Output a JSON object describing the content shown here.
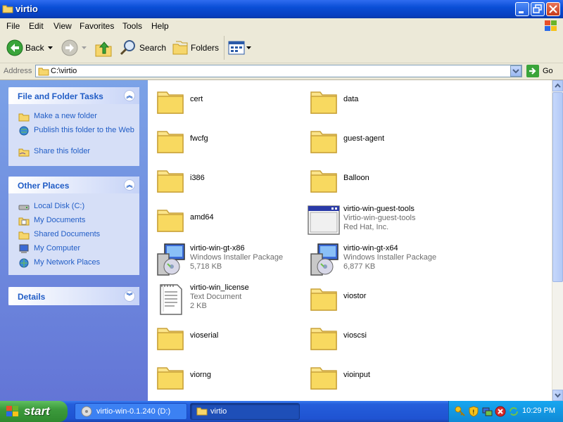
{
  "window": {
    "title": "virtio"
  },
  "menu": [
    "File",
    "Edit",
    "View",
    "Favorites",
    "Tools",
    "Help"
  ],
  "toolbar": {
    "back": "Back",
    "search": "Search",
    "folders": "Folders"
  },
  "address": {
    "label": "Address",
    "value": "C:\\virtio",
    "go": "Go"
  },
  "tasks": {
    "file_folder": {
      "title": "File and Folder Tasks",
      "items": [
        "Make a new folder",
        "Publish this folder to the Web",
        "Share this folder"
      ]
    },
    "other_places": {
      "title": "Other Places",
      "items": [
        "Local Disk (C:)",
        "My Documents",
        "Shared Documents",
        "My Computer",
        "My Network Places"
      ]
    },
    "details": {
      "title": "Details"
    }
  },
  "files": [
    {
      "name": "cert",
      "type": "folder"
    },
    {
      "name": "data",
      "type": "folder"
    },
    {
      "name": "fwcfg",
      "type": "folder"
    },
    {
      "name": "guest-agent",
      "type": "folder"
    },
    {
      "name": "i386",
      "type": "folder"
    },
    {
      "name": "Balloon",
      "type": "folder"
    },
    {
      "name": "amd64",
      "type": "folder"
    },
    {
      "name": "virtio-win-guest-tools",
      "line2": "Virtio-win-guest-tools",
      "line3": "Red Hat, Inc.",
      "type": "app"
    },
    {
      "name": "virtio-win-gt-x86",
      "line2": "Windows Installer Package",
      "line3": "5,718 KB",
      "type": "msi"
    },
    {
      "name": "virtio-win-gt-x64",
      "line2": "Windows Installer Package",
      "line3": "6,877 KB",
      "type": "msi"
    },
    {
      "name": "virtio-win_license",
      "line2": "Text Document",
      "line3": "2 KB",
      "type": "txt"
    },
    {
      "name": "viostor",
      "type": "folder"
    },
    {
      "name": "vioserial",
      "type": "folder"
    },
    {
      "name": "vioscsi",
      "type": "folder"
    },
    {
      "name": "viorng",
      "type": "folder"
    },
    {
      "name": "vioinput",
      "type": "folder"
    }
  ],
  "taskbar": {
    "start": "start",
    "buttons": [
      "virtio-win-0.1.240 (D:)",
      "virtio"
    ],
    "clock": "10:29 PM"
  },
  "colors": {
    "title_bar": "#0a4ed6",
    "task_link": "#215dc6",
    "taskbar": "#245edb",
    "start": "#3c9a3c"
  }
}
